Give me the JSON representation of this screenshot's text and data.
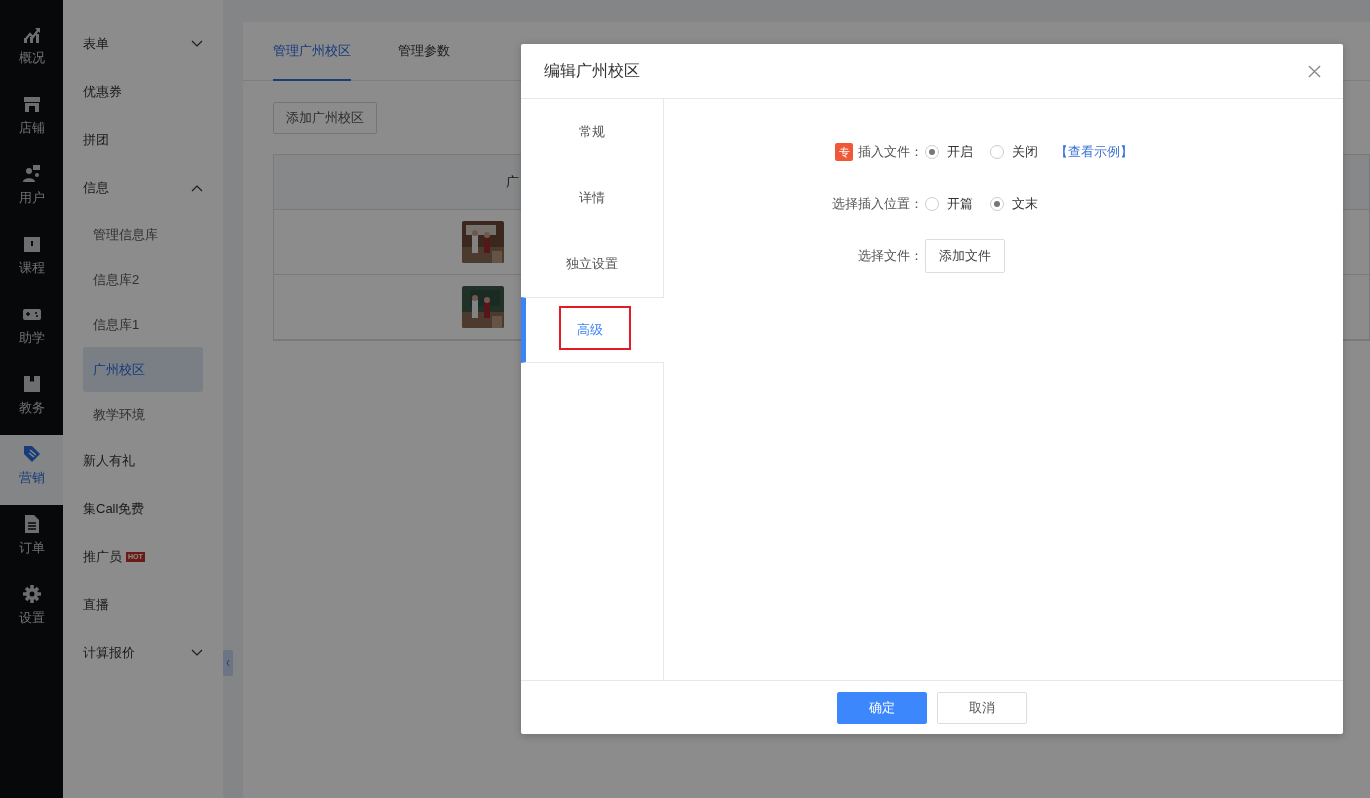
{
  "rail": [
    {
      "label": "概况",
      "selected": false
    },
    {
      "label": "店铺",
      "selected": false
    },
    {
      "label": "用户",
      "selected": false
    },
    {
      "label": "课程",
      "selected": false
    },
    {
      "label": "助学",
      "selected": false
    },
    {
      "label": "教务",
      "selected": false
    },
    {
      "label": "营销",
      "selected": true
    },
    {
      "label": "订单",
      "selected": false
    },
    {
      "label": "设置",
      "selected": false
    }
  ],
  "submenu": [
    {
      "label": "表单",
      "expanded": false,
      "selected": false
    },
    {
      "label": "优惠券",
      "selected": false
    },
    {
      "label": "拼团",
      "selected": false
    },
    {
      "label": "信息",
      "expanded": true,
      "selected": false,
      "children": [
        {
          "label": "管理信息库",
          "selected": false
        },
        {
          "label": "信息库2",
          "selected": false
        },
        {
          "label": "信息库1",
          "selected": false
        },
        {
          "label": "广州校区",
          "selected": true
        },
        {
          "label": "教学环境",
          "selected": false
        }
      ]
    },
    {
      "label": "新人有礼",
      "selected": false
    },
    {
      "label": "集Call免费",
      "selected": false
    },
    {
      "label": "推广员",
      "badge": "HOT",
      "selected": false
    },
    {
      "label": "直播",
      "selected": false
    },
    {
      "label": "计算报价",
      "expanded": false,
      "selected": false
    }
  ],
  "page": {
    "tabs": [
      {
        "label": "管理广州校区",
        "selected": true
      },
      {
        "label": "管理参数",
        "selected": false
      }
    ],
    "add_button": "添加广州校区",
    "table": {
      "columns": [
        "广"
      ],
      "rows": [
        {
          "image": {
            "kind": "picture"
          }
        },
        {
          "image": {
            "kind": "picture"
          }
        }
      ]
    }
  },
  "dialog": {
    "title": "编辑广州校区",
    "tabs": [
      {
        "label": "常规",
        "selected": false
      },
      {
        "label": "详情",
        "selected": false
      },
      {
        "label": "独立设置",
        "selected": false
      },
      {
        "label": "高级",
        "selected": true,
        "highlighted": true
      }
    ],
    "fields": [
      {
        "kind": "radio",
        "badge": "专",
        "label": "插入文件：",
        "options": [
          {
            "label": "开启",
            "selected": true
          },
          {
            "label": "关闭",
            "selected": false
          }
        ],
        "link": "【查看示例】"
      },
      {
        "kind": "radio",
        "label": "选择插入位置：",
        "options": [
          {
            "label": "开篇",
            "selected": false
          },
          {
            "label": "文末",
            "selected": true
          }
        ]
      },
      {
        "kind": "file",
        "label": "选择文件：",
        "button": "添加文件"
      }
    ],
    "buttons": [
      {
        "label": "确定",
        "kind": "primary"
      },
      {
        "label": "取消",
        "kind": "default"
      }
    ]
  }
}
